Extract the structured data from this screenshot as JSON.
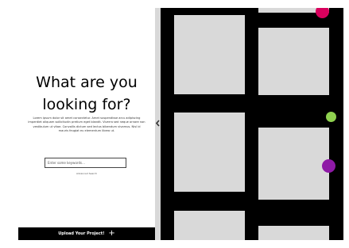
{
  "left_panel": {
    "headline": "What are you looking for?",
    "intro": "Lorem ipsum dolor sit amet consectetur. Amet suspendisse arcu adipiscing imperdiet aliquam sollicitudin pretium eget blandit. Viverra sed neque ornare non vestibulum ut vitae. Convallis dictum sed lectus bibendum vivamus. Nisl id mauris feugiat eu elementum libero ut.",
    "search": {
      "placeholder": "Enter some keywords...",
      "value": ""
    },
    "advanced_search": "Advanced Search",
    "upload": {
      "label": "Upload Your Project!",
      "icon": "plus-icon"
    }
  },
  "divider": {
    "handle_icon": "chevron-left-icon"
  },
  "map": {
    "background": "#000000",
    "block_color": "#d9d9d9",
    "pins": [
      {
        "name": "magenta",
        "color": "#d8005d"
      },
      {
        "name": "green",
        "color": "#8fd14f"
      },
      {
        "name": "purple",
        "color": "#8e1aa6"
      }
    ]
  }
}
